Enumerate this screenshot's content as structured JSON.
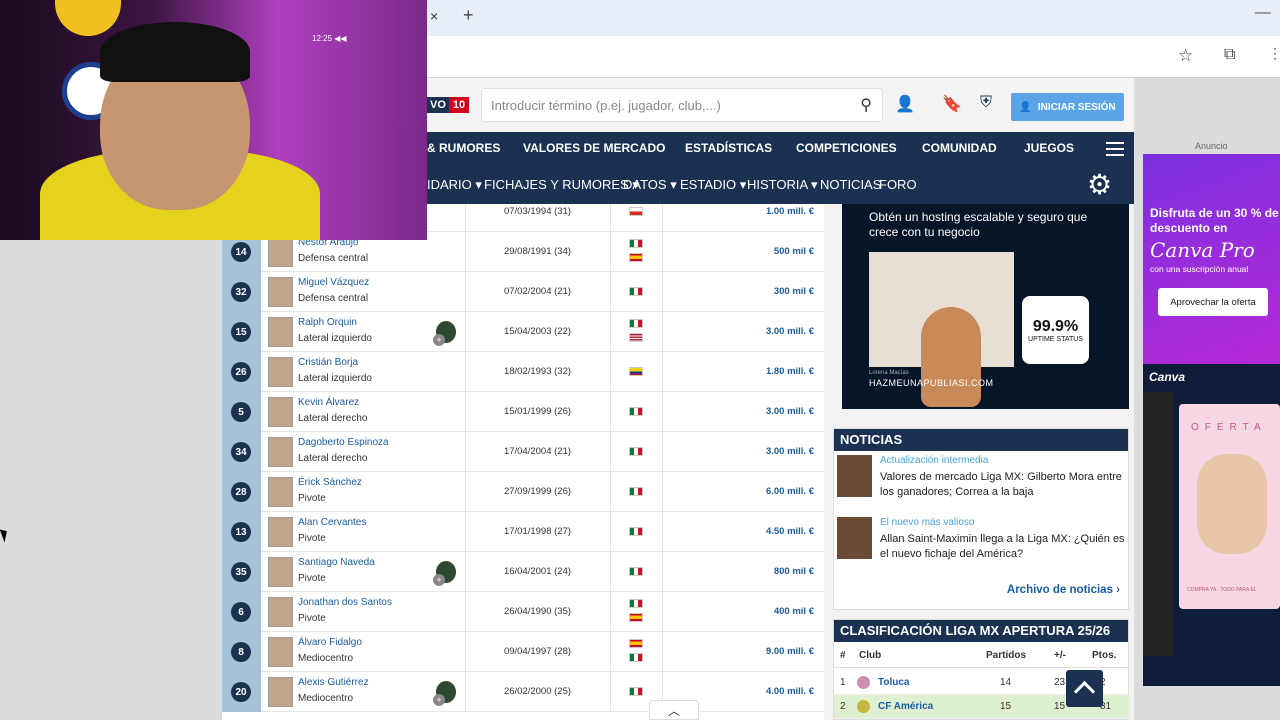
{
  "browser": {
    "tab_close": "×",
    "tab_new": "+",
    "minimize": "—"
  },
  "header": {
    "live_label": "VO",
    "live_count": "10",
    "search_placeholder": "Introducir término (p.ej. jugador, club,...)",
    "login_label": "INICIAR SESIÓN"
  },
  "main_nav": [
    "& RUMORES",
    "VALORES DE MERCADO",
    "ESTADÍSTICAS",
    "COMPETICIONES",
    "COMUNIDAD",
    "JUEGOS"
  ],
  "sub_nav": [
    "IDARIO ▾",
    "FICHAJES Y RUMORES ▾",
    "DATOS ▾",
    "ESTADIO ▾",
    "HISTORIA ▾",
    "NOTICIAS",
    "FORO"
  ],
  "webcam": {
    "clock": "12:25 ◀◀"
  },
  "players": [
    {
      "number": "",
      "name": "",
      "position": "",
      "date": "07/03/1994 (31)",
      "flags": [
        "cl"
      ],
      "value": "1.00 mill. €",
      "club": false
    },
    {
      "number": "14",
      "name": "Néstor Araújo",
      "position": "Defensa central",
      "date": "29/08/1991 (34)",
      "flags": [
        "mx",
        "es"
      ],
      "value": "500 mil €",
      "club": false
    },
    {
      "number": "32",
      "name": "Miguel Vázquez",
      "position": "Defensa central",
      "date": "07/02/2004 (21)",
      "flags": [
        "mx"
      ],
      "value": "300 mil €",
      "club": false
    },
    {
      "number": "15",
      "name": "Ralph Orquin",
      "position": "Lateral izquierdo",
      "date": "15/04/2003 (22)",
      "flags": [
        "mx",
        "us"
      ],
      "value": "3.00 mill. €",
      "club": true
    },
    {
      "number": "26",
      "name": "Cristián Borja",
      "position": "Lateral izquierdo",
      "date": "18/02/1993 (32)",
      "flags": [
        "co"
      ],
      "value": "1.80 mill. €",
      "club": false
    },
    {
      "number": "5",
      "name": "Kevin Álvarez",
      "position": "Lateral derecho",
      "date": "15/01/1999 (26)",
      "flags": [
        "mx"
      ],
      "value": "3.00 mill. €",
      "club": false
    },
    {
      "number": "34",
      "name": "Dagoberto Espinoza",
      "position": "Lateral derecho",
      "date": "17/04/2004 (21)",
      "flags": [
        "mx"
      ],
      "value": "3.00 mill. €",
      "club": false
    },
    {
      "number": "28",
      "name": "Érick Sánchez",
      "position": "Pivote",
      "date": "27/09/1999 (26)",
      "flags": [
        "mx"
      ],
      "value": "6.00 mill. €",
      "club": false
    },
    {
      "number": "13",
      "name": "Alan Cervantes",
      "position": "Pivote",
      "date": "17/01/1998 (27)",
      "flags": [
        "mx"
      ],
      "value": "4.50 mill. €",
      "club": false
    },
    {
      "number": "35",
      "name": "Santiago Naveda",
      "position": "Pivote",
      "date": "16/04/2001 (24)",
      "flags": [
        "mx"
      ],
      "value": "800 mil €",
      "club": true
    },
    {
      "number": "6",
      "name": "Jonathan dos Santos",
      "position": "Pivote",
      "date": "26/04/1990 (35)",
      "flags": [
        "mx",
        "es"
      ],
      "value": "400 mil €",
      "club": false
    },
    {
      "number": "8",
      "name": "Álvaro Fidalgo",
      "position": "Mediocentro",
      "date": "09/04/1997 (28)",
      "flags": [
        "es",
        "mx"
      ],
      "value": "9.00 mill. €",
      "club": false
    },
    {
      "number": "20",
      "name": "Alexis Gutiérrez",
      "position": "Mediocentro",
      "date": "26/02/2000 (25)",
      "flags": [
        "mx"
      ],
      "value": "4.00 mill. €",
      "club": true
    }
  ],
  "ad_hosting": {
    "headline": "Obtén un hosting escalable y seguro que crece con tu negocio",
    "uptime": "99.9%",
    "uptime_label": "UPTIME STATUS",
    "signature": "Lorena Macías",
    "domain": "HAZMEUNAPUBLIASI.COM"
  },
  "news": {
    "title": "NOTICIAS",
    "items": [
      {
        "kicker": "Actualización intermedia",
        "headline": "Valores de mercado Liga MX: Gilberto Mora entre los ganadores; Correa a la baja"
      },
      {
        "kicker": "El nuevo más valioso",
        "headline": "Allan Saint-Maximin llega a la Liga MX: ¿Quién es el nuevo fichaje del América?"
      }
    ],
    "archive": "Archivo de noticias ›"
  },
  "standings": {
    "title": "CLASIFICACIÓN LIGA MX APERTURA 25/26",
    "headers": {
      "pos": "#",
      "club": "Club",
      "played": "Partidos",
      "diff": "+/-",
      "pts": "Ptos."
    },
    "rows": [
      {
        "pos": "1",
        "club": "Toluca",
        "played": "14",
        "diff": "23",
        "pts": "2"
      },
      {
        "pos": "2",
        "club": "CF América",
        "played": "15",
        "diff": "15",
        "pts": "31"
      }
    ]
  },
  "side_ad": {
    "label": "Anuncio",
    "line1": "Disfruta de un 30 % de descuento en",
    "brand": "Canva Pro",
    "line3": "con una suscripción anual",
    "cta": "Aprovechar la oferta",
    "app_brand": "Canva",
    "card_title": "OFERTA",
    "card_fine": "COMPRA YA · TODO PARA EL"
  },
  "colors": {
    "navy": "#1a3151",
    "link": "#1a5da6",
    "accent_blue": "#5ba4e8",
    "number_column": "#a7c1d6"
  }
}
